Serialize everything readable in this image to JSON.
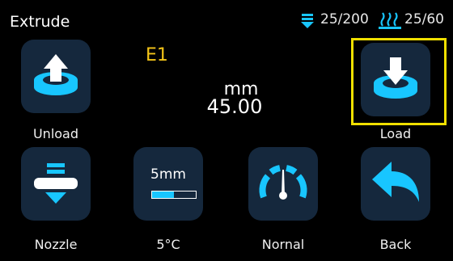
{
  "header": {
    "title": "Extrude",
    "nozzle_temp": "25/200",
    "bed_temp": "25/60",
    "nozzle_icon": "nozzle-icon",
    "bed_icon": "heatbed-icon"
  },
  "display": {
    "extruder": "E1",
    "unit": "mm",
    "amount": "45.00"
  },
  "buttons": {
    "unload": "Unload",
    "load": "Load",
    "nozzle": "Nozzle",
    "step": "5mm",
    "step_progress": 0.5,
    "temp": "5°C",
    "speed": "Nornal",
    "back": "Back"
  },
  "colors": {
    "accent": "#18c6ff",
    "tile": "#15283d",
    "highlight": "#f0e000",
    "extruder_label": "#f5c518"
  }
}
